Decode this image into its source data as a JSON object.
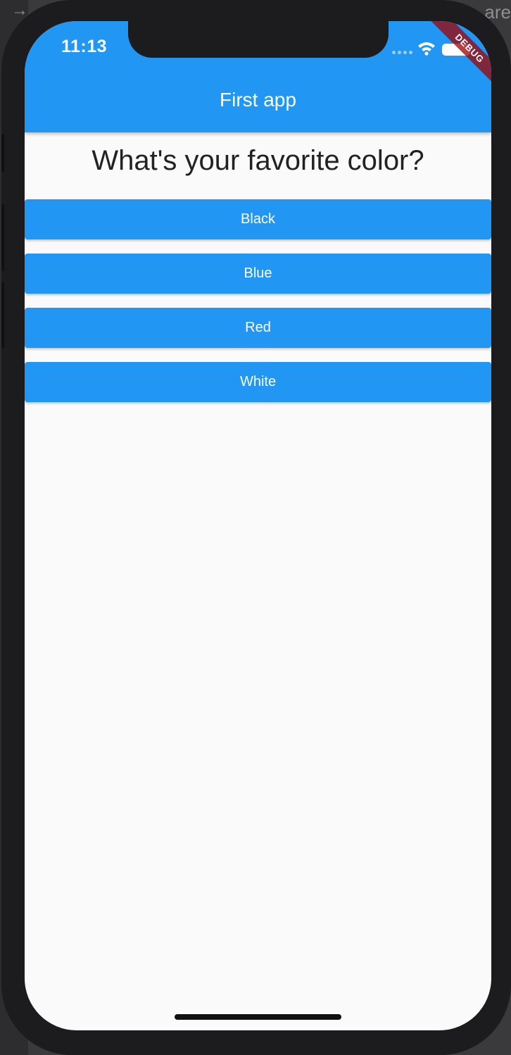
{
  "status_bar": {
    "time": "11:13"
  },
  "app_bar": {
    "title": "First app",
    "color": "#2196f3"
  },
  "debug_banner": {
    "label": "DEBUG"
  },
  "question": {
    "text": "What's your favorite color?"
  },
  "answers": [
    {
      "label": "Black"
    },
    {
      "label": "Blue"
    },
    {
      "label": "Red"
    },
    {
      "label": "White"
    }
  ],
  "backdrop": {
    "partial_text": "are"
  },
  "icons": {
    "wifi": "wifi-icon",
    "battery": "battery-icon",
    "signal": "signal-dots-icon"
  }
}
